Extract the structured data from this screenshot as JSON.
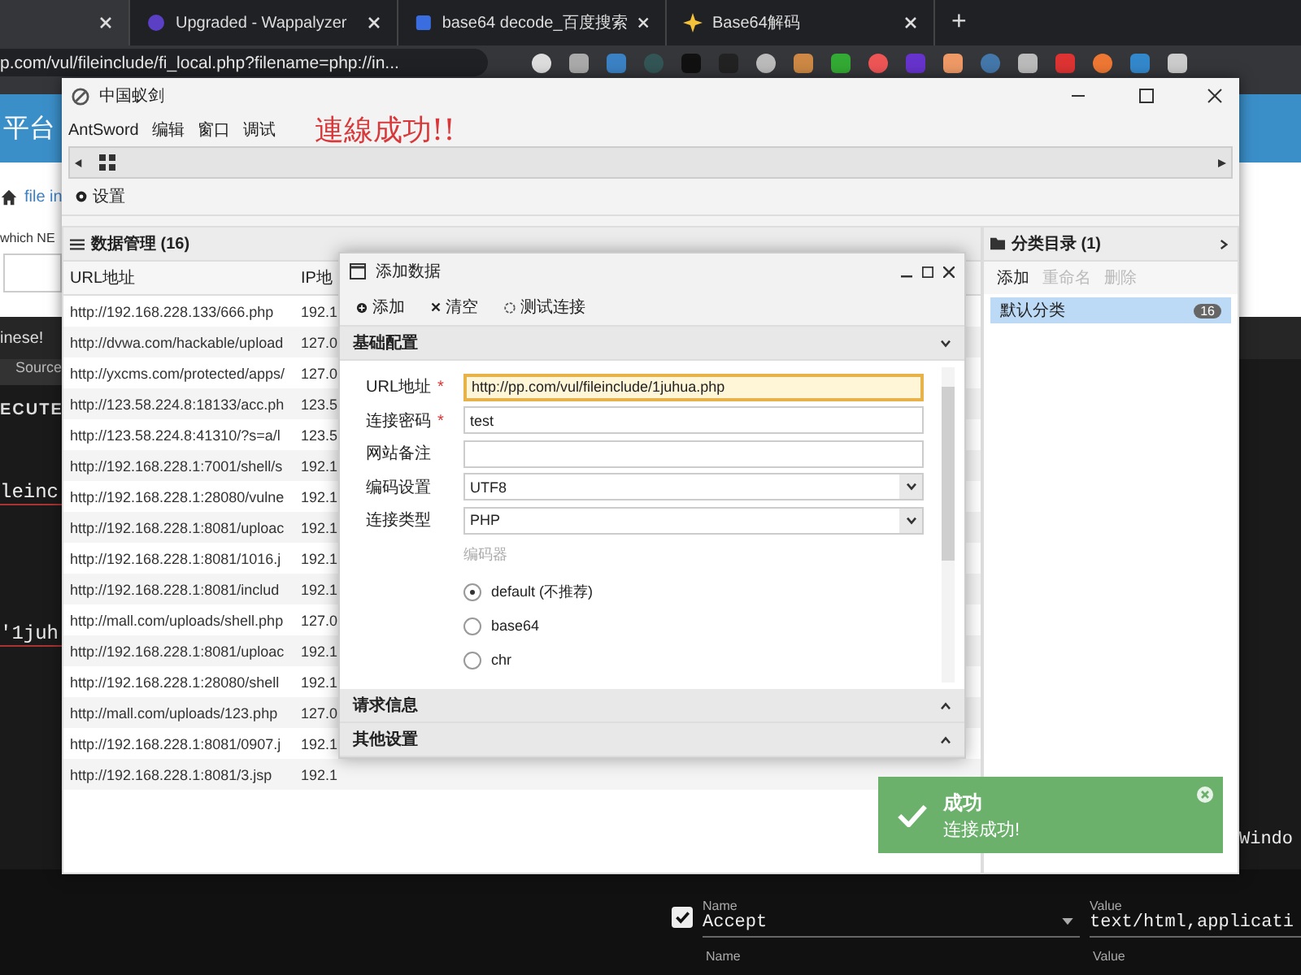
{
  "browser": {
    "tabs": [
      {
        "selected": true
      },
      {
        "title": "Upgraded - Wappalyzer",
        "selected": false
      },
      {
        "title": "base64 decode_百度搜索",
        "selected": false
      },
      {
        "title": "Base64解码",
        "selected": false
      }
    ],
    "new_tab": "+",
    "address": "p.com/vul/fileinclude/fi_local.php?filename=php://in..."
  },
  "page": {
    "header": "平台",
    "breadcrumb": "file in",
    "question": "which NE",
    "notice": "inese!",
    "tab": "Source",
    "button": "ECUTE",
    "code_lines": [
      "leinc",
      "'1juh"
    ],
    "side_text": "Windo",
    "header_row": {
      "checked": true,
      "name_label": "Name",
      "name": "Accept",
      "value_label": "Value",
      "value": "text/html,applicati"
    },
    "next_row": {
      "name_label": "Name",
      "value_label": "Value"
    }
  },
  "antsword": {
    "title": "中国蚁剑",
    "menu": [
      "AntSword",
      "编辑",
      "窗口",
      "调试"
    ],
    "annotation": "連線成功!!",
    "toolbar": [
      "设置"
    ],
    "data_panel": {
      "title": "数据管理 (16)",
      "columns": [
        "URL地址",
        "IP地"
      ],
      "rows": [
        {
          "url": "http://192.168.228.133/666.php",
          "ip": "192.1"
        },
        {
          "url": "http://dvwa.com/hackable/upload",
          "ip": "127.0"
        },
        {
          "url": "http://yxcms.com/protected/apps/",
          "ip": "127.0"
        },
        {
          "url": "http://123.58.224.8:18133/acc.ph",
          "ip": "123.5"
        },
        {
          "url": "http://123.58.224.8:41310/?s=a/l",
          "ip": "123.5"
        },
        {
          "url": "http://192.168.228.1:7001/shell/s",
          "ip": "192.1"
        },
        {
          "url": "http://192.168.228.1:28080/vulne",
          "ip": "192.1"
        },
        {
          "url": "http://192.168.228.1:8081/uploac",
          "ip": "192.1"
        },
        {
          "url": "http://192.168.228.1:8081/1016.j",
          "ip": "192.1"
        },
        {
          "url": "http://192.168.228.1:8081/includ",
          "ip": "192.1"
        },
        {
          "url": "http://mall.com/uploads/shell.php",
          "ip": "127.0"
        },
        {
          "url": "http://192.168.228.1:8081/uploac",
          "ip": "192.1"
        },
        {
          "url": "http://192.168.228.1:28080/shell",
          "ip": "192.1"
        },
        {
          "url": "http://mall.com/uploads/123.php",
          "ip": "127.0"
        },
        {
          "url": "http://192.168.228.1:8081/0907.j",
          "ip": "192.1"
        },
        {
          "url": "http://192.168.228.1:8081/3.jsp",
          "ip": "192.1"
        }
      ]
    },
    "category_panel": {
      "title": "分类目录 (1)",
      "actions": [
        {
          "label": "添加",
          "disabled": false
        },
        {
          "label": "重命名",
          "disabled": true
        },
        {
          "label": "删除",
          "disabled": true
        }
      ],
      "items": [
        {
          "label": "默认分类",
          "count": "16",
          "selected": true
        }
      ]
    }
  },
  "dialog": {
    "title": "添加数据",
    "toolbar": [
      "添加",
      "清空",
      "测试连接"
    ],
    "sections": [
      {
        "title": "基础配置",
        "expanded": true
      },
      {
        "title": "请求信息",
        "expanded": false
      },
      {
        "title": "其他设置",
        "expanded": false
      }
    ],
    "fields": [
      {
        "label": "URL地址",
        "required_mark": "*",
        "kind": "text",
        "value": "http://pp.com/vul/fileinclude/1juhua.php",
        "focused": true
      },
      {
        "label": "连接密码",
        "required_mark": "*",
        "kind": "text",
        "value": "test",
        "focused": false
      },
      {
        "label": "网站备注",
        "kind": "text",
        "focused": false
      },
      {
        "label": "编码设置",
        "kind": "select",
        "value": "UTF8"
      },
      {
        "label": "连接类型",
        "kind": "select",
        "value": "PHP"
      }
    ],
    "encoder": {
      "label": "编码器",
      "options": [
        {
          "label": "default (不推荐)",
          "selected": true
        },
        {
          "label": "base64",
          "selected": false
        },
        {
          "label": "chr",
          "selected": false
        }
      ]
    }
  },
  "toast": {
    "title": "成功",
    "message": "连接成功!"
  }
}
